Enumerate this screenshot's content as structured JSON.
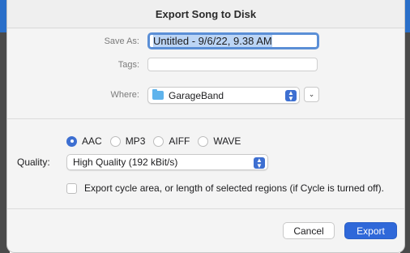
{
  "dialog": {
    "title": "Export Song to Disk",
    "save_as_label": "Save As:",
    "save_as_value": "Untitled - 9/6/22, 9.38 AM",
    "tags_label": "Tags:",
    "tags_value": "",
    "where_label": "Where:",
    "where_value": "GarageBand",
    "formats": [
      {
        "label": "AAC",
        "selected": true
      },
      {
        "label": "MP3",
        "selected": false
      },
      {
        "label": "AIFF",
        "selected": false
      },
      {
        "label": "WAVE",
        "selected": false
      }
    ],
    "quality_label": "Quality:",
    "quality_value": "High Quality (192 kBit/s)",
    "cycle_checkbox_label": "Export cycle area, or length of selected regions (if Cycle is turned off).",
    "cycle_checked": false,
    "cancel_label": "Cancel",
    "export_label": "Export"
  },
  "colors": {
    "accent": "#2f68d9",
    "folder": "#5fb3ec"
  }
}
